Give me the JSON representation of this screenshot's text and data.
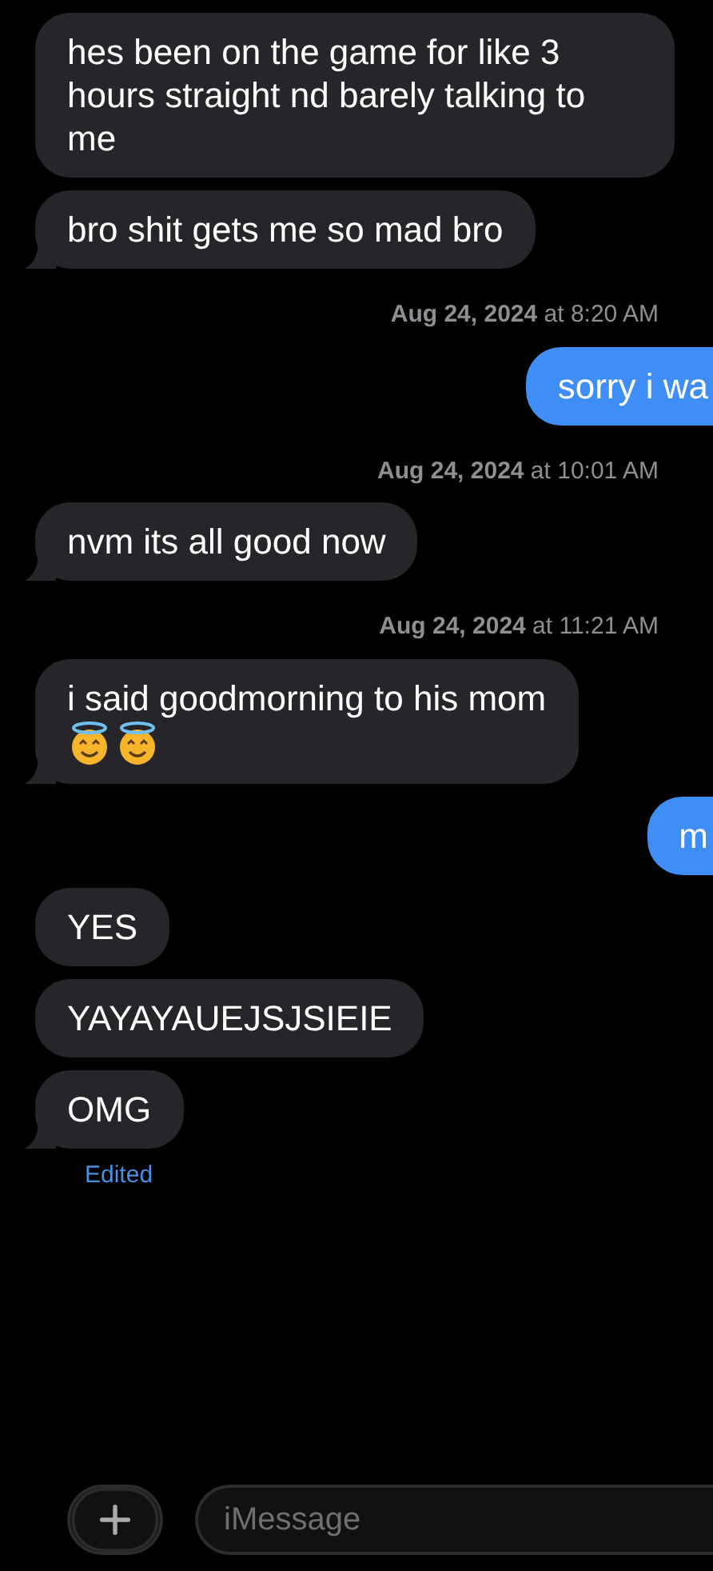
{
  "messages": [
    {
      "kind": "incoming",
      "text": "hes been on the game for like 3 hours straight nd barely talking to me",
      "tail": false
    },
    {
      "kind": "incoming",
      "text": "bro shit gets me so mad bro",
      "tail": true
    },
    {
      "kind": "timestamp",
      "text": "**Aug 24, 2024** at 8:20 AM"
    },
    {
      "kind": "outgoing",
      "text": "sorry i wa"
    },
    {
      "kind": "timestamp",
      "text": "**Aug 24, 2024** at 10:01 AM"
    },
    {
      "kind": "incoming",
      "text": "nvm its all good now",
      "tail": true
    },
    {
      "kind": "timestamp",
      "text": "**Aug 24, 2024** at 11:21 AM"
    },
    {
      "kind": "incoming",
      "text": "i said goodmorning to his mom",
      "icons": [
        {
          "kind": "halo-face"
        },
        {
          "kind": "halo-face"
        }
      ],
      "tail": true
    },
    {
      "kind": "outgoing",
      "text": "m"
    },
    {
      "kind": "incoming",
      "text": "YES",
      "tail": false
    },
    {
      "kind": "incoming",
      "text": "YAYAYAUEJSJSIEIE",
      "tail": false
    },
    {
      "kind": "incoming",
      "text": "OMG",
      "tail": true
    },
    {
      "kind": "edited",
      "text": "Edited"
    }
  ],
  "composer": {
    "placeholder": "iMessage"
  }
}
